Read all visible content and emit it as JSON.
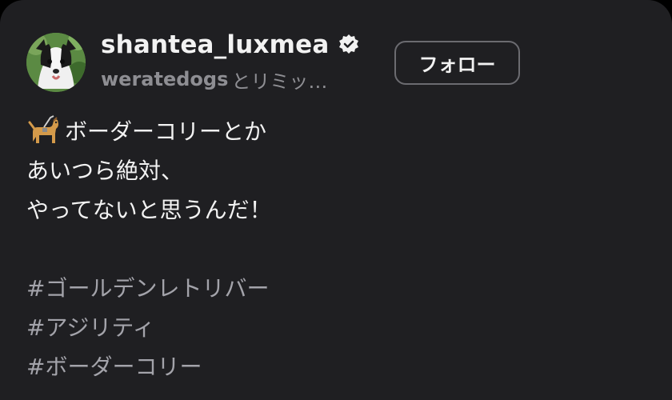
{
  "post": {
    "username": "shantea_luxmea",
    "verified": true,
    "collab_user": "weratedogs",
    "collab_suffix": "とリミッ…",
    "follow_label": "フォロー"
  },
  "caption": {
    "emoji_icon": "guide-dog-icon",
    "line1": "ボーダーコリーとか",
    "line2": "あいつら絶対、",
    "line3": "やってないと思うんだ！",
    "hashtags": [
      "#ゴールデンレトリバー",
      "#アジリティ",
      "#ボーダーコリー"
    ]
  },
  "colors": {
    "background": "#1f1f22",
    "text": "#f2f2f2",
    "muted": "#8e8e93",
    "hashtag": "#a3a3aa",
    "button_border": "#6b6b70"
  }
}
